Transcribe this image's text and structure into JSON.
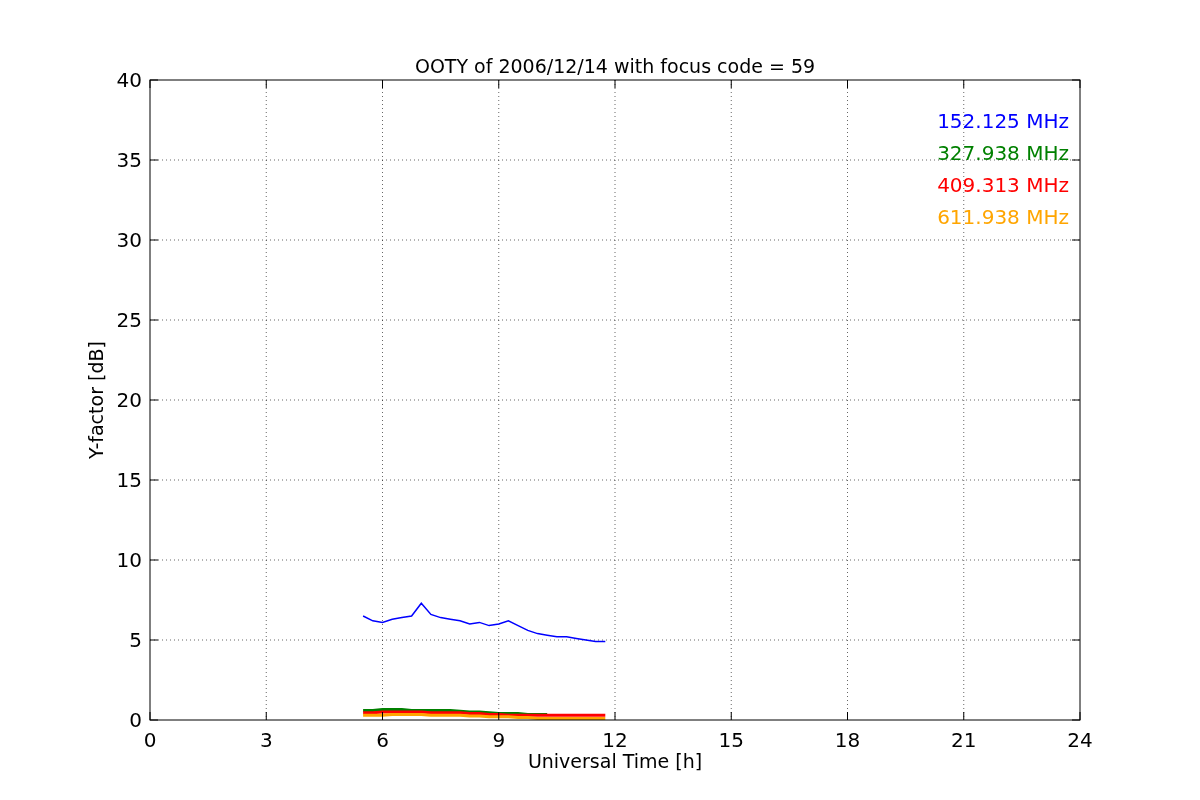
{
  "figure": {
    "chart_data": {
      "type": "line",
      "title": "OOTY of 2006/12/14 with focus code = 59",
      "xlabel": "Universal Time [h]",
      "ylabel": "Y-factor [dB]",
      "x": [
        5.5,
        5.75,
        6.0,
        6.25,
        6.5,
        6.75,
        7.0,
        7.25,
        7.5,
        7.75,
        8.0,
        8.25,
        8.5,
        8.75,
        9.0,
        9.25,
        9.5,
        9.75,
        10.0,
        10.25,
        10.5,
        10.75,
        11.0,
        11.25,
        11.5,
        11.75
      ],
      "series": [
        {
          "name": "152.125 MHz",
          "color": "#0000ff",
          "values": [
            6.5,
            6.2,
            6.1,
            6.3,
            6.4,
            6.5,
            7.3,
            6.6,
            6.4,
            6.3,
            6.2,
            6.0,
            6.1,
            5.9,
            6.0,
            6.2,
            5.9,
            5.6,
            5.4,
            5.3,
            5.2,
            5.2,
            5.1,
            5.0,
            4.9,
            4.9
          ]
        },
        {
          "name": "327.938 MHz",
          "color": "#008000",
          "values": [
            0.6,
            0.6,
            0.65,
            0.65,
            0.65,
            0.6,
            0.6,
            0.6,
            0.6,
            0.6,
            0.55,
            0.5,
            0.5,
            0.45,
            0.4,
            0.4,
            0.4,
            0.35,
            0.35,
            0.35,
            null,
            null,
            null,
            null,
            null,
            null
          ]
        },
        {
          "name": "409.313 MHz",
          "color": "#ff0000",
          "values": [
            0.45,
            0.45,
            0.5,
            0.5,
            0.5,
            0.5,
            0.5,
            0.45,
            0.45,
            0.45,
            0.45,
            0.4,
            0.4,
            0.35,
            0.35,
            0.3,
            0.3,
            0.3,
            0.3,
            0.3,
            0.3,
            0.3,
            0.3,
            0.3,
            0.3,
            0.3
          ]
        },
        {
          "name": "611.938 MHz",
          "color": "#ffa500",
          "values": [
            0.3,
            0.3,
            0.3,
            0.35,
            0.35,
            0.35,
            0.35,
            0.3,
            0.3,
            0.3,
            0.3,
            0.25,
            0.25,
            0.2,
            0.2,
            0.2,
            0.15,
            0.15,
            0.1,
            0.1,
            0.1,
            0.1,
            0.1,
            0.1,
            0.1,
            0.1
          ]
        }
      ],
      "grid": true,
      "xlim": [
        0,
        24
      ],
      "ylim": [
        0,
        40
      ],
      "xticks": [
        0,
        3,
        6,
        9,
        12,
        15,
        18,
        21,
        24
      ],
      "yticks": [
        0,
        5,
        10,
        15,
        20,
        25,
        30,
        35,
        40
      ]
    }
  }
}
